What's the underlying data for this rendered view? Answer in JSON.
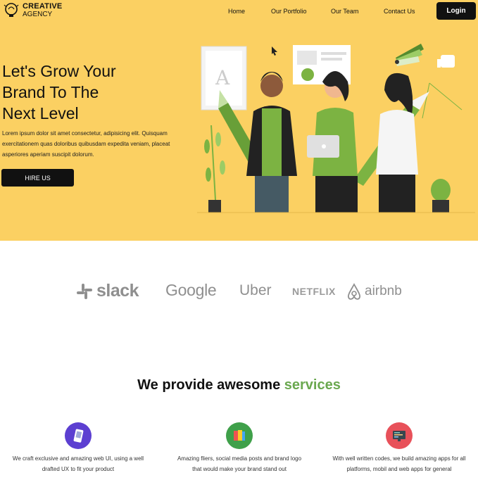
{
  "header": {
    "logo": {
      "line1": "CREATIVE",
      "line2": "AGENCY",
      "icon": "lightbulb-icon"
    },
    "nav": [
      "Home",
      "Our Portfolio",
      "Our Team",
      "Contact Us"
    ],
    "login_label": "Login"
  },
  "hero": {
    "title_lines": [
      "Let's Grow Your",
      "Brand To The",
      "Next Level"
    ],
    "description": "Lorem ipsum dolor sit amet consectetur, adipisicing elit. Quisquam exercitationem quas doloribus quibusdam expedita veniam, placeat asperiores aperiam suscipit dolorum.",
    "cta_label": "HIRE US",
    "background_color": "#fbd062"
  },
  "brands": [
    "slack",
    "Google",
    "Uber",
    "NETFLIX",
    "airbnb"
  ],
  "services": {
    "title_prefix": "We provide awesome",
    "title_accent": "services",
    "accent_color": "#6aa84f",
    "items": [
      {
        "icon": "mobile-design-icon",
        "text": "We craft exclusive and amazing web UI, using a well drafted UX to fit your product"
      },
      {
        "icon": "color-palette-icon",
        "text": "Amazing fliers, social media posts and brand logo that would make your brand stand out"
      },
      {
        "icon": "code-monitor-icon",
        "text": "With well written codes, we build amazing apps for all platforms, mobil and web apps for general"
      }
    ]
  }
}
